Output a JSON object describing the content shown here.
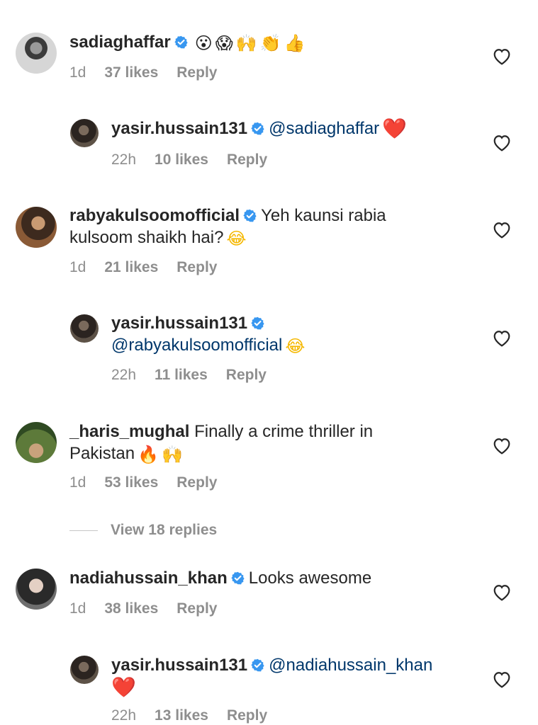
{
  "colors": {
    "verified": "#3897f0",
    "mention": "#00376b",
    "meta": "#8e8e8e"
  },
  "comments": [
    {
      "user": "sadiaghaffar",
      "verified": true,
      "text": "",
      "emojis": [
        "😮",
        "😱",
        "🙌",
        "👏",
        "👍"
      ],
      "time": "1d",
      "likes": "37 likes",
      "reply": "Reply"
    },
    {
      "user": "yasir.hussain131",
      "verified": true,
      "mention": "@sadiaghaffar",
      "emojis": [
        "❤️"
      ],
      "time": "22h",
      "likes": "10 likes",
      "reply": "Reply"
    },
    {
      "user": "rabyakulsoomofficial",
      "verified": true,
      "text": "Yeh kaunsi rabia kulsoom shaikh hai?",
      "emojis": [
        "😂"
      ],
      "time": "1d",
      "likes": "21 likes",
      "reply": "Reply"
    },
    {
      "user": "yasir.hussain131",
      "verified": true,
      "mention": "@rabyakulsoomofficial",
      "emojis": [
        "😂"
      ],
      "time": "22h",
      "likes": "11 likes",
      "reply": "Reply"
    },
    {
      "user": "_haris_mughal",
      "verified": false,
      "text": "Finally a crime thriller in Pakistan",
      "emojis": [
        "🔥",
        "🙌"
      ],
      "time": "1d",
      "likes": "53 likes",
      "reply": "Reply"
    },
    {
      "user": "nadiahussain_khan",
      "verified": true,
      "text": "Looks awesome",
      "emojis": [],
      "time": "1d",
      "likes": "38 likes",
      "reply": "Reply"
    },
    {
      "user": "yasir.hussain131",
      "verified": true,
      "mention": "@nadiahussain_khan",
      "emojis": [
        "❤️"
      ],
      "time": "22h",
      "likes": "13 likes",
      "reply": "Reply"
    }
  ],
  "view_replies": "View 18 replies"
}
